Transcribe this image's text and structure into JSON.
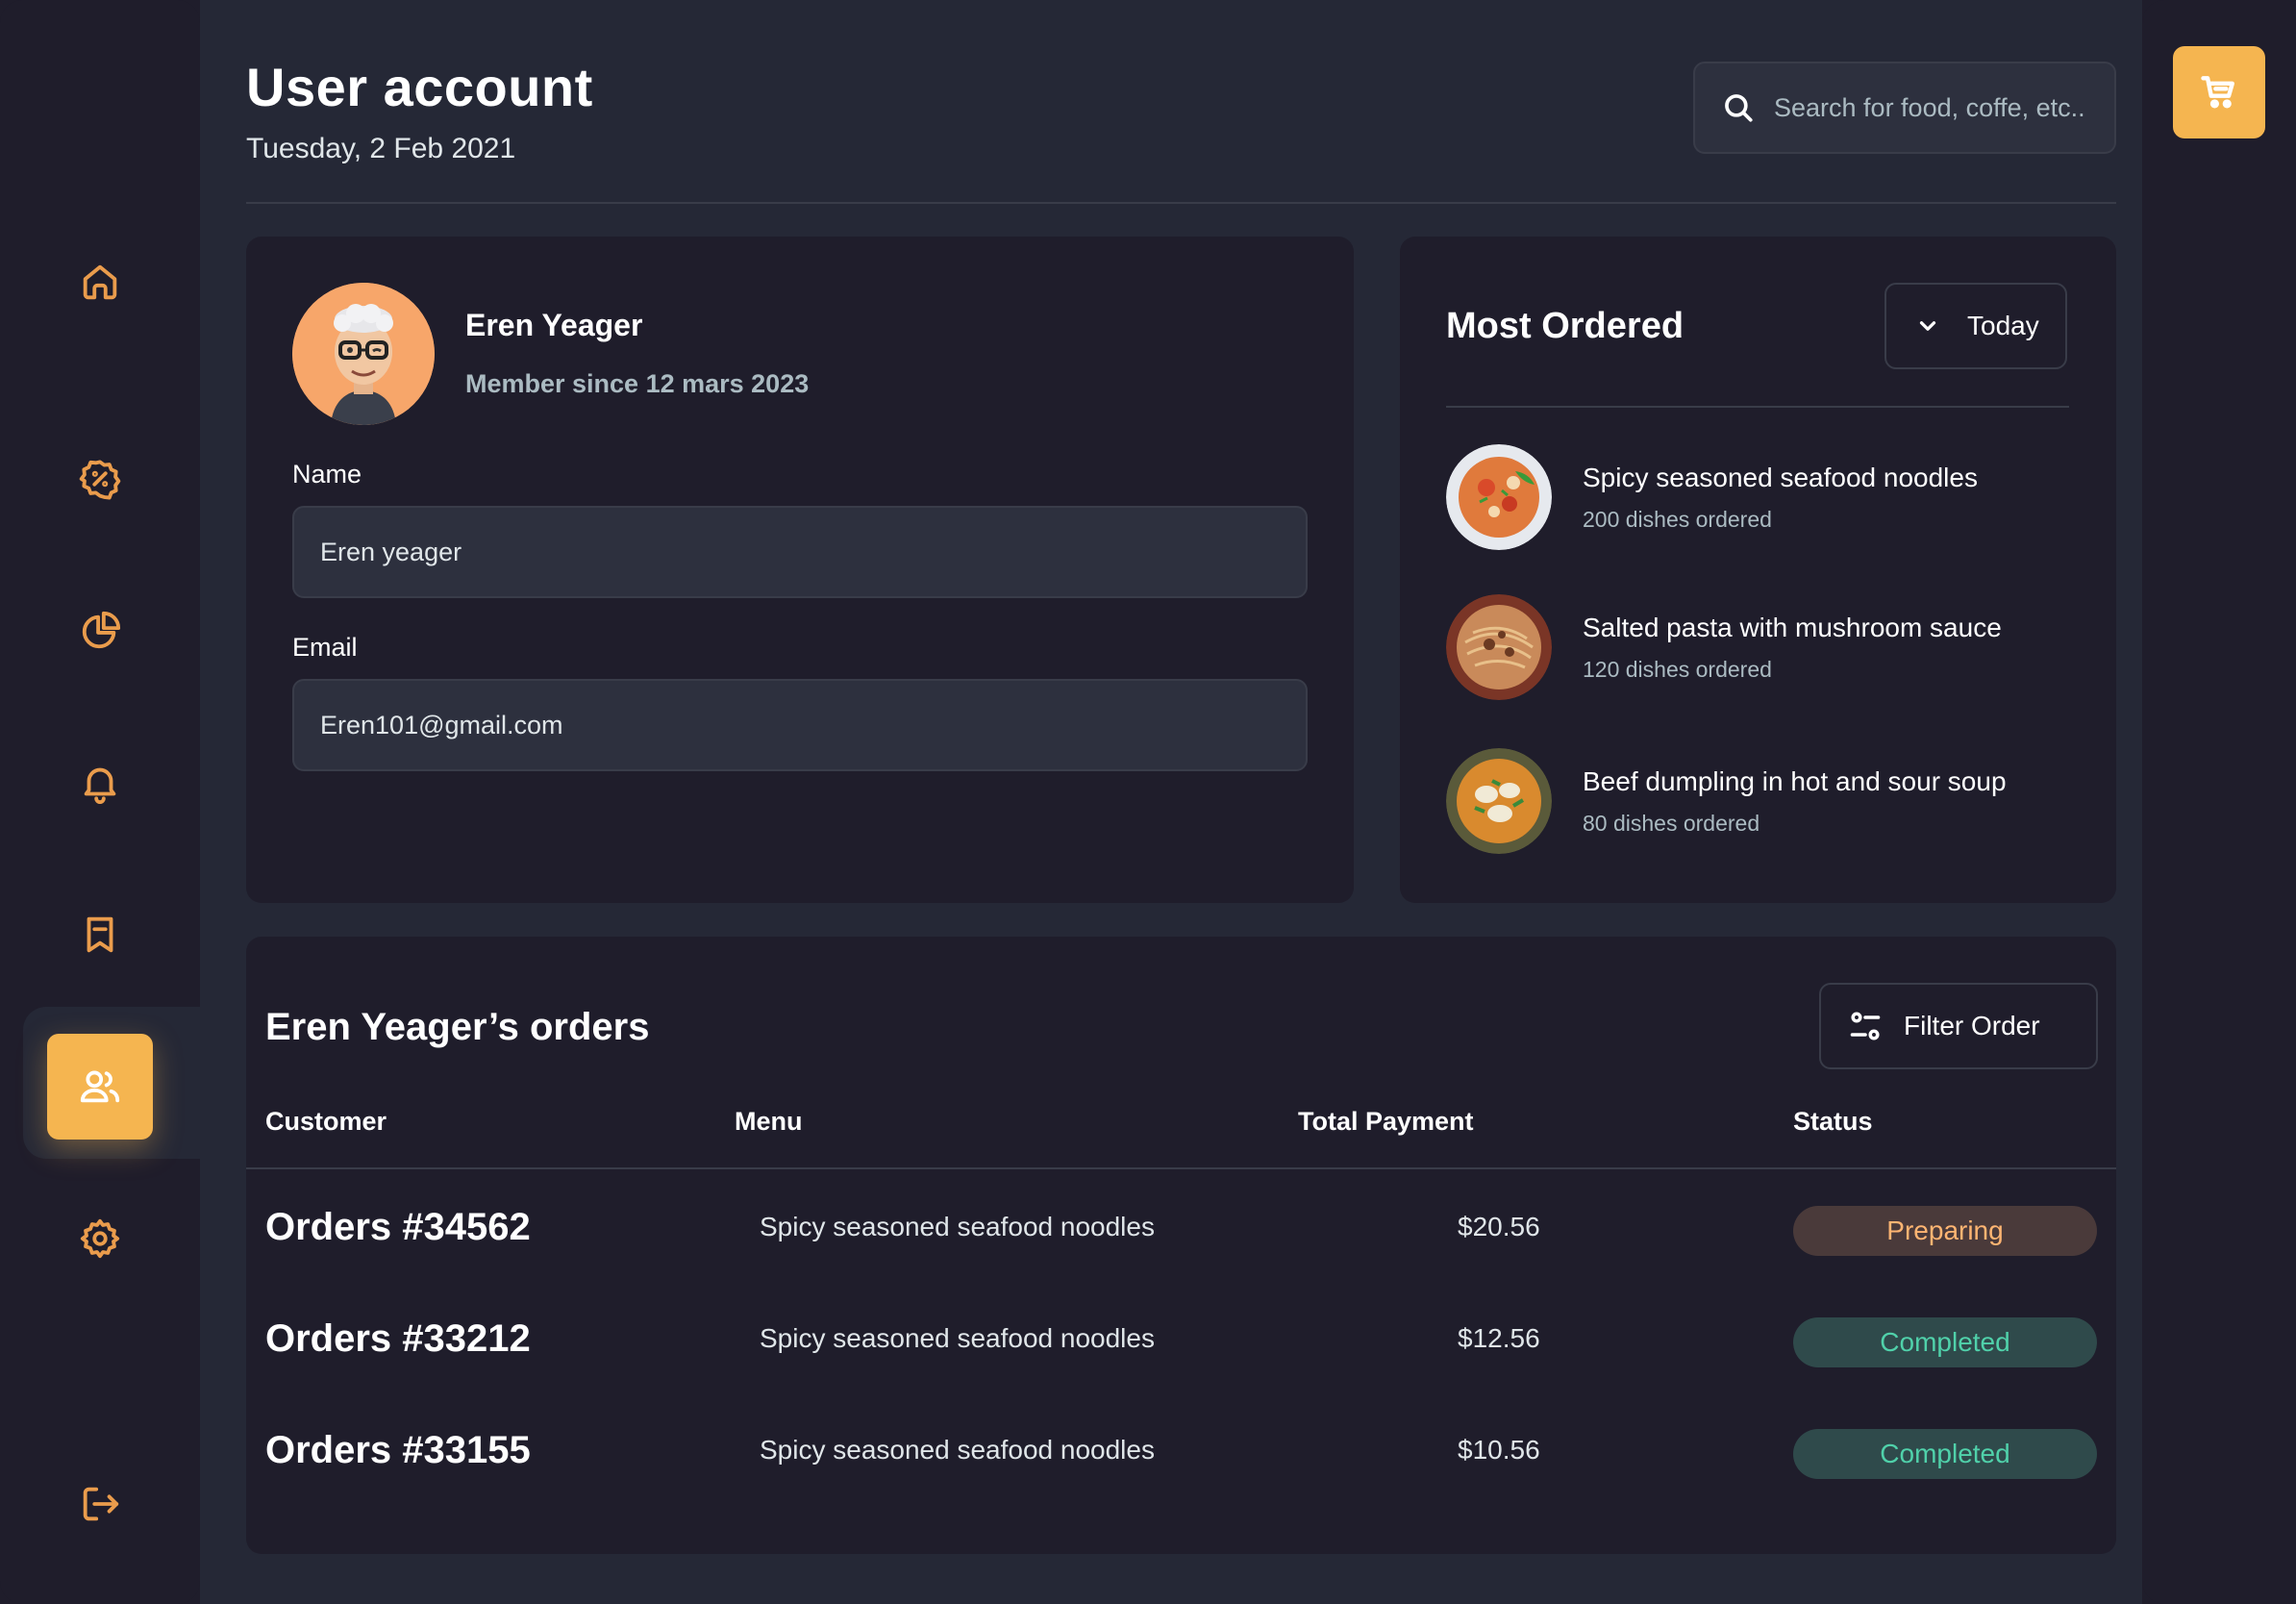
{
  "header": {
    "title": "User account",
    "date": "Tuesday, 2 Feb 2021"
  },
  "search": {
    "placeholder": "Search for food, coffe, etc.."
  },
  "sidebar": {
    "items": [
      {
        "icon": "home-icon"
      },
      {
        "icon": "discount-icon"
      },
      {
        "icon": "pie-chart-icon"
      },
      {
        "icon": "bell-icon"
      },
      {
        "icon": "bookmark-icon"
      },
      {
        "icon": "users-icon",
        "active": true
      },
      {
        "icon": "gear-icon"
      },
      {
        "icon": "logout-icon"
      }
    ]
  },
  "profile": {
    "name": "Eren Yeager",
    "member_since": "Member since 12 mars 2023",
    "name_label": "Name",
    "name_value": "Eren yeager",
    "email_label": "Email",
    "email_value": "Eren101@gmail.com"
  },
  "most_ordered": {
    "title": "Most Ordered",
    "period": "Today",
    "items": [
      {
        "name": "Spicy seasoned seafood noodles",
        "count": "200 dishes ordered"
      },
      {
        "name": "Salted pasta with mushroom sauce",
        "count": "120 dishes ordered"
      },
      {
        "name": "Beef dumpling in hot and sour soup",
        "count": "80 dishes ordered"
      }
    ]
  },
  "orders": {
    "title": "Eren Yeager’s orders",
    "filter_label": "Filter Order",
    "columns": [
      "Customer",
      "Menu",
      "Total Payment",
      "Status"
    ],
    "rows": [
      {
        "order": "Orders #34562",
        "menu": "Spicy seasoned seafood noodles",
        "payment": "$20.56",
        "status": "Preparing"
      },
      {
        "order": "Orders #33212",
        "menu": "Spicy seasoned seafood noodles",
        "payment": "$12.56",
        "status": "Completed"
      },
      {
        "order": "Orders #33155",
        "menu": "Spicy seasoned seafood noodles",
        "payment": "$10.56",
        "status": "Completed"
      }
    ]
  },
  "colors": {
    "background": "#252836",
    "panel": "#1f1d2b",
    "accent": "#f5b550",
    "icon": "#ea9c4c",
    "preparing": "#ffb572",
    "completed": "#50d1aa"
  }
}
